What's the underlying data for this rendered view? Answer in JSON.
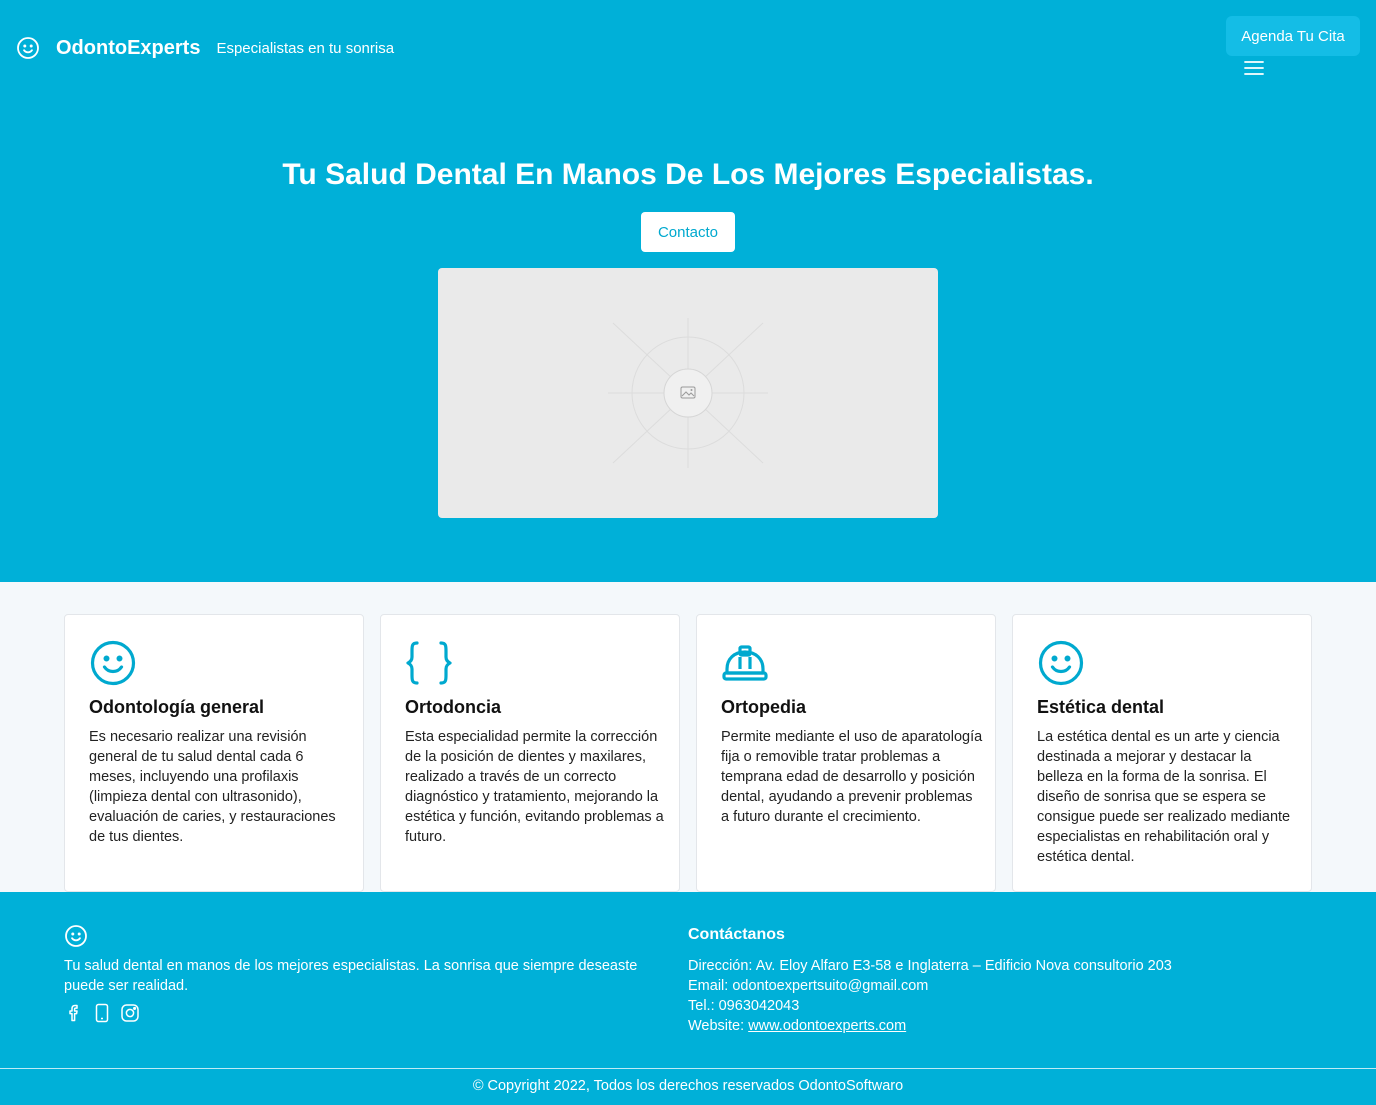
{
  "header": {
    "brand_name": "OdontoExperts",
    "tagline": "Especialistas en tu sonrisa",
    "cta_label": "Agenda Tu Cita",
    "logo_icon": "smile-icon",
    "menu_icon": "hamburger-menu-icon"
  },
  "hero": {
    "title": "Tu Salud Dental En Manos De Los Mejores Especialistas.",
    "contact_label": "Contacto",
    "image_icon": "image-placeholder-icon"
  },
  "services": [
    {
      "icon": "smile-icon",
      "title": "Odontología general",
      "text": "Es necesario realizar una revisión general de tu salud dental cada 6 meses, incluyendo una profilaxis (limpieza dental con ultrasonido), evaluación de caries, y restauraciones de tus dientes."
    },
    {
      "icon": "braces-icon",
      "title": "Ortodoncia",
      "text": "Esta especialidad permite la corrección de la posición de dientes y maxilares, realizado a través de un correcto diagnóstico y tratamiento, mejorando la estética y función, evitando problemas a futuro."
    },
    {
      "icon": "helmet-icon",
      "title": "Ortopedia",
      "text": "Permite mediante el uso de aparatología fija o removible tratar problemas a temprana edad de desarrollo y posición dental, ayudando a prevenir problemas a futuro durante el crecimiento."
    },
    {
      "icon": "smile-icon",
      "title": "Estética dental",
      "text": "La estética dental es un arte y ciencia destinada a mejorar y destacar la belleza en la forma de la sonrisa. El diseño de sonrisa que se espera se consigue puede ser realizado mediante especialistas en rehabilitación oral y estética dental."
    }
  ],
  "footer": {
    "about": "Tu salud dental en manos de los mejores especialistas. La sonrisa que siempre deseaste puede ser realidad.",
    "socials": [
      "facebook-icon",
      "phone-icon",
      "instagram-icon"
    ],
    "contact_heading": "Contáctanos",
    "address": "Dirección: Av. Eloy Alfaro E3-58 e Inglaterra – Edificio Nova consultorio 203",
    "email": "Email: odontoexpertsuito@gmail.com",
    "phone": "Tel.: 0963042043",
    "website_prefix": "Website: ",
    "website": "www.odontoexperts.com",
    "copyright": "© Copyright 2022, Todos los derechos reservados OdontoSoftwaro"
  },
  "colors": {
    "primary": "#00b0d8",
    "cta_bg": "#14bde6",
    "section_bg": "#f4f8fb",
    "icon_accent": "#00a9cf"
  }
}
